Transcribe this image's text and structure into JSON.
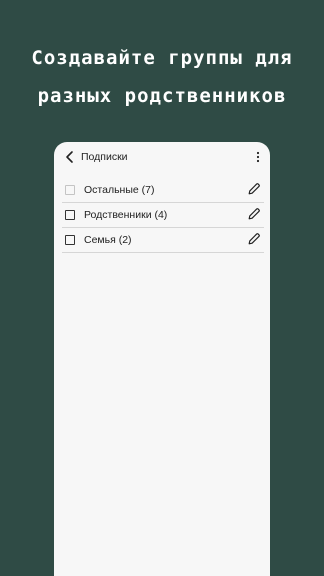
{
  "promo": {
    "line1": "Создавайте группы для",
    "line2": "разных родственников"
  },
  "colors": {
    "background": "#2f4b45",
    "screen": "#f7f7f7",
    "text": "#222222"
  },
  "app": {
    "title": "Подписки",
    "icons": {
      "back": "chevron-left-icon",
      "more": "more-vertical-icon",
      "edit": "pencil-icon"
    },
    "groups": [
      {
        "label": "Остальные (7)",
        "checked": false,
        "enabled": false
      },
      {
        "label": "Родственники (4)",
        "checked": false,
        "enabled": true
      },
      {
        "label": "Семья (2)",
        "checked": false,
        "enabled": true
      }
    ]
  }
}
